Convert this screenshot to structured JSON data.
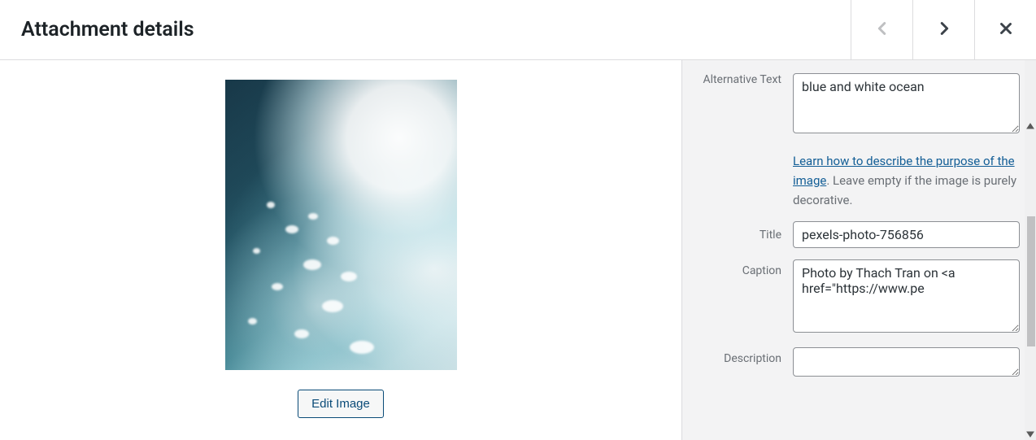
{
  "header": {
    "title": "Attachment details"
  },
  "fields": {
    "alt": {
      "label": "Alternative Text",
      "value": "blue and white ocean",
      "help_link_text": "Learn how to describe the purpose of the image",
      "help_suffix": ". Leave empty if the image is purely decorative."
    },
    "title": {
      "label": "Title",
      "value": "pexels-photo-756856"
    },
    "caption": {
      "label": "Caption",
      "value": "Photo by Thach Tran on <a href=\"https://www.pe"
    },
    "description": {
      "label": "Description",
      "value": ""
    }
  },
  "actions": {
    "edit_image": "Edit Image"
  }
}
